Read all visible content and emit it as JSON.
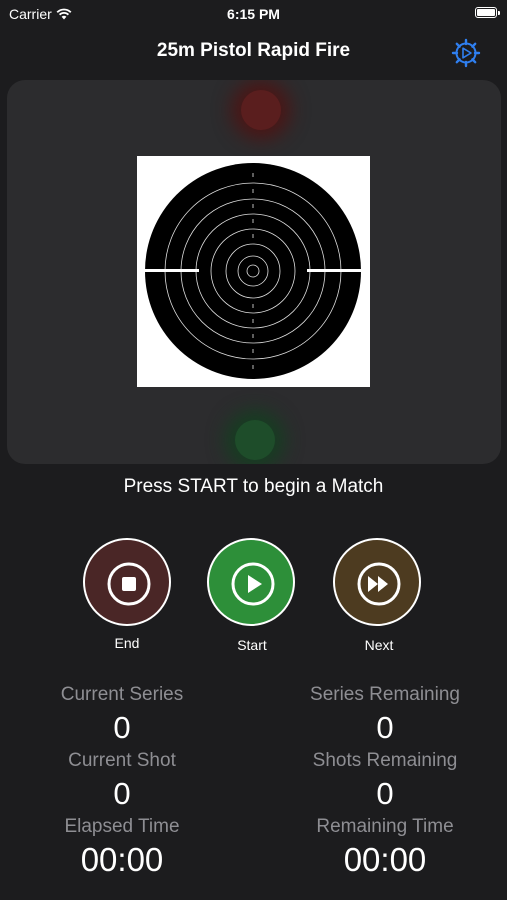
{
  "status_bar": {
    "carrier": "Carrier",
    "time": "6:15 PM"
  },
  "nav": {
    "title": "25m Pistol Rapid Fire",
    "settings_icon": "gear-play-icon"
  },
  "lights": {
    "top_color": "#5a1e1e",
    "bottom_color": "#1e4d2a"
  },
  "prompt": "Press START to begin a Match",
  "controls": {
    "end": {
      "label": "End",
      "color": "#4a2626",
      "icon": "stop-icon"
    },
    "start": {
      "label": "Start",
      "color": "#2d8f39",
      "icon": "play-icon"
    },
    "next": {
      "label": "Next",
      "color": "#4d3b20",
      "icon": "fast-forward-icon"
    }
  },
  "stats": {
    "current_series": {
      "label": "Current Series",
      "value": "0"
    },
    "series_remaining": {
      "label": "Series Remaining",
      "value": "0"
    },
    "current_shot": {
      "label": "Current Shot",
      "value": "0"
    },
    "shots_remaining": {
      "label": "Shots  Remaining",
      "value": "0"
    },
    "elapsed_time": {
      "label": "Elapsed Time",
      "value": "00:00"
    },
    "remaining_time": {
      "label": "Remaining Time",
      "value": "00:00"
    }
  }
}
